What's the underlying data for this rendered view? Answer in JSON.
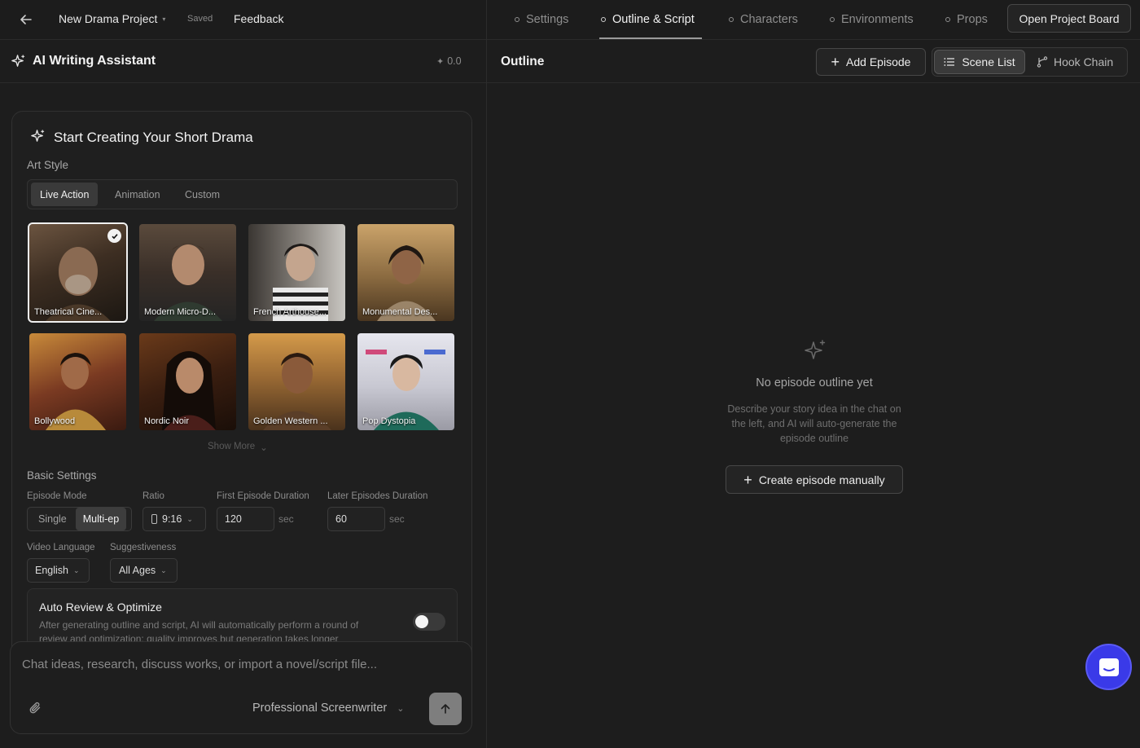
{
  "header": {
    "project_title": "New Drama Project",
    "save_status": "Saved",
    "feedback_label": "Feedback",
    "tabs": [
      {
        "label": "Settings",
        "active": false
      },
      {
        "label": "Outline & Script",
        "active": true
      },
      {
        "label": "Characters",
        "active": false
      },
      {
        "label": "Environments",
        "active": false
      },
      {
        "label": "Props",
        "active": false
      }
    ],
    "open_board_label": "Open Project Board"
  },
  "assistant": {
    "title": "AI Writing Assistant",
    "credits": "0.0"
  },
  "start_card": {
    "title": "Start Creating Your Short Drama",
    "art_style_label": "Art Style",
    "style_tabs": [
      {
        "label": "Live Action",
        "active": true
      },
      {
        "label": "Animation",
        "active": false
      },
      {
        "label": "Custom",
        "active": false
      }
    ],
    "styles": [
      {
        "label": "Theatrical Cine...",
        "selected": true
      },
      {
        "label": "Modern Micro-D...",
        "selected": false
      },
      {
        "label": "French Arthouse...",
        "selected": false
      },
      {
        "label": "Monumental Des...",
        "selected": false
      },
      {
        "label": "Bollywood",
        "selected": false
      },
      {
        "label": "Nordic Noir",
        "selected": false
      },
      {
        "label": "Golden Western ...",
        "selected": false
      },
      {
        "label": "Pop Dystopia",
        "selected": false
      }
    ],
    "show_more_label": "Show More",
    "basic_settings_label": "Basic Settings",
    "episode_mode": {
      "label": "Episode Mode",
      "options": [
        "Single",
        "Multi-ep"
      ],
      "selected": "Multi-ep"
    },
    "ratio": {
      "label": "Ratio",
      "value": "9:16"
    },
    "first_duration": {
      "label": "First Episode Duration",
      "value": "120",
      "unit": "sec"
    },
    "later_duration": {
      "label": "Later Episodes Duration",
      "value": "60",
      "unit": "sec"
    },
    "video_language": {
      "label": "Video Language",
      "value": "English"
    },
    "suggestiveness": {
      "label": "Suggestiveness",
      "value": "All Ages"
    },
    "auto_review": {
      "title": "Auto Review & Optimize",
      "description_line1": "After generating outline and script, AI will automatically perform a round of",
      "description_line2": "review and optimization; quality improves but generation takes longer",
      "enabled": false
    }
  },
  "chat": {
    "placeholder": "Chat ideas, research, discuss works, or import a novel/script file...",
    "persona": "Professional Screenwriter"
  },
  "outline": {
    "title": "Outline",
    "add_episode_label": "Add Episode",
    "view_toggle": [
      {
        "label": "Scene List",
        "active": true
      },
      {
        "label": "Hook Chain",
        "active": false
      }
    ],
    "empty_title": "No episode outline yet",
    "empty_desc_lines": [
      "Describe your story idea in the chat on",
      "the left, and AI will auto-generate the",
      "episode outline"
    ],
    "create_manual_label": "Create episode manually"
  },
  "colors": {
    "background": "#1d1d1d",
    "panel_border": "#2b2b2b",
    "help_fab": "#3a3ae8"
  }
}
